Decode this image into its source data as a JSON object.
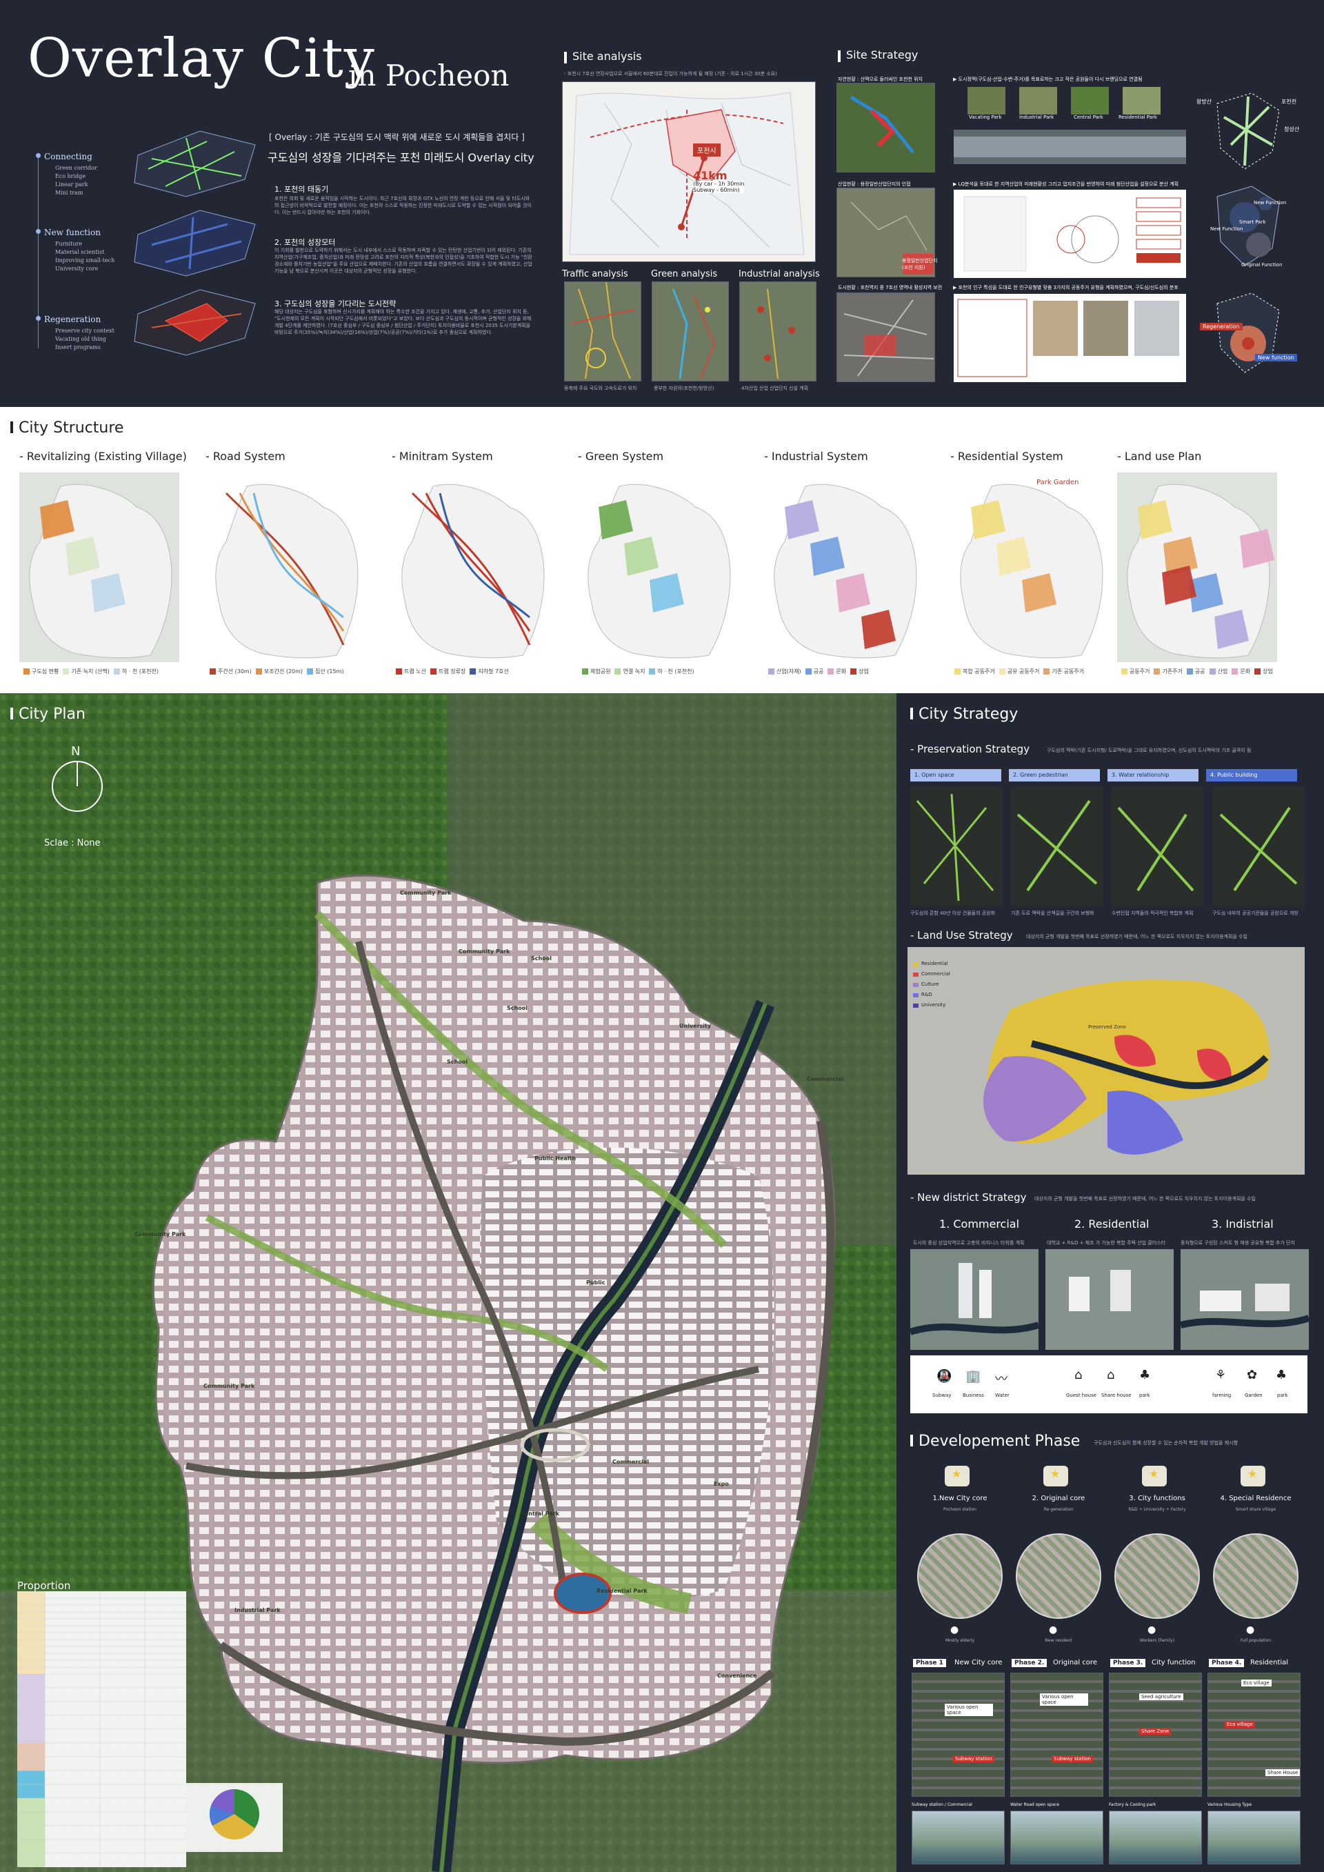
{
  "header": {
    "title": "Overlay City",
    "subtitle": "in Pocheon",
    "overlay_heading": "[ Overlay : 기존 구도심의 도시 맥락 위에 새로운 도시 계획들을 겹치다 ]",
    "overlay_tagline": "구도심의 성장을 기다려주는 포천 미래도시 Overlay city"
  },
  "layers": [
    {
      "label": "Connecting",
      "items": [
        "Green corridor",
        "Eco bridge",
        "Linear park",
        "Mini tram"
      ]
    },
    {
      "label": "New function",
      "items": [
        "Furniture",
        "Material scientist",
        "Improving small-tech",
        "University core"
      ]
    },
    {
      "label": "Regeneration",
      "items": [
        "Preserve city context",
        "Vacating old thing",
        "Insert programs"
      ]
    }
  ],
  "sections": [
    {
      "heading": "1. 포천의 태동기",
      "body": "포천은 의회 및 새로운 움직임을 시작하는 도시이다. 최근 7호선의 확장과 GTX 노선의 연장 계란 등으로 인해 서울 및 타도시와의 접근성이 비약적으로 발전할 예정이다. 이는 포천의 스스로 작동하는 진정한 미래도시로 도약할 수 있는 시작점이 되어줄 것이다. 이는 반드시 잡아야만 하는 포천의 기회이다."
    },
    {
      "heading": "2. 포천의 성장모터",
      "body": "이 기회를 발판으로 도약하기 위해서는 도시 내부에서 스스로 작동하며 자족할 수 있는 탄탄한 산업기반이 되어 제외된다. 기존의 지역산업(가구제조업, 중처산업)과 미래 전망성 고려로 포천의 지리적 특성(북한과의 인접성)을 기초하여 적합한 도시 기능 \"친환경소재와 중처기반 농업산업\"을 주요 산업으로 제배치한다. 기존의 산업의 흐름을 연결하면서도 확장될 수 있게 계획하였고, 산업기능을 남 북으로 분산시켜 이곳은 대상지의 균형적인 성장을 유형한다."
    },
    {
      "heading": "3. 구도심의 성장을 기다리는 도시전략",
      "body": "해당 대상지는 구도심을 포함하며 신시가지를 계획해야 하는 특수한 조건을 가지고 있다. 재생에, 교통, 추가, 산업단지 위치 등, \"도시현재의 모든 계획이 시작되던 구도심에서 비롯되었다\"고 보았다. 보다 산도심과 구도심의 동시적이며 균형적인 성장을 위해 개발 4단계를 제안하였다. (7호선 중심부 / 구도심 중심부 / 첨단산업 / 주거단지) 토지이용비율로 포천시 2035 도시기본계획을 바탕으로 주거(35%)/녹지(34%)/산업(16%)/상업(7%)/공공(7%)/기타(1%)로 추가 중심으로 계획하였다."
    }
  ],
  "site_analysis": {
    "title": "Site analysis",
    "caption": "- 포천시 7호선 연장사업으로 서울에서 60분대로 진입이 가능하게 될 예정 (기준 - 의료 1시간 30분 소요)",
    "callout_city": "포천시",
    "callout_distance": "41km",
    "callout_detail": "(By car - 1h 30min\nSubway - 60min)",
    "sub_panels": [
      {
        "label": "Traffic analysis",
        "caption": "동축에 주요 국도와 고속도로가 위치"
      },
      {
        "label": "Green analysis",
        "caption": "풍부한 자원의(포천천/왕방산)"
      },
      {
        "label": "Industrial analysis",
        "caption": "4차산업 산업 산업단지 신설 계획"
      }
    ]
  },
  "site_strategy": {
    "title": "Site Strategy",
    "rows": [
      {
        "left_caption": "자연현황 : 산맥으로 둘러싸인 포천천 위치",
        "note": "▶ 도시정맥(구도심-산업-수변-주거)를 목표로하는 크고 작은 공원들이 다시 브랜딩으로 연결됨",
        "parks": [
          "Vacating Park",
          "Industrial Park",
          "Central Park",
          "Residential Park"
        ],
        "callouts": [
          "왕방산",
          "포천천",
          "청성산"
        ]
      },
      {
        "left_caption": "산업현황 : 용정일반산업단지의 인접",
        "note": "▶ LQ분석을 토대로 한 지역산업의 미래현황성 그리고 업지조건을 반영하여 미래 첨단산업을 설정으로 분산 계획",
        "callouts": [
          "New Function",
          "Smart Park",
          "New Function",
          "Original Function"
        ],
        "badge": "용정일반산업단지\n(포천 지원)"
      },
      {
        "left_caption": "도시현황 : 포천역지 중 7호선 영역내 활성지역 보전",
        "note": "▶ 포천의 인구 특성을 도대로 한 인구유형별 맞춤 3가지의 공동주거 유형을 계획하였으며, 구도심/신도심의 분포",
        "callouts": [
          "Regeneration",
          "New function"
        ]
      }
    ]
  },
  "city_structure": {
    "title": "City Structure",
    "panels": [
      {
        "title": "- Revitalizing (Existing Village)",
        "legend": [
          "구도심 현황",
          "기존 녹지 (산맥)",
          "하 · 천 (포천천)"
        ],
        "colors": [
          "#e08a3c",
          "#d9e8c9",
          "#bfd7ea"
        ]
      },
      {
        "title": "- Road System",
        "legend": [
          "주간선 (30m)",
          "보조간선 (20m)",
          "집산 (15m)"
        ],
        "colors": [
          "#b5452e",
          "#e0924b",
          "#6bb6e6"
        ]
      },
      {
        "title": "- Minitram System",
        "legend": [
          "트램 노선",
          "트램 정류장",
          "지하철 7호선"
        ],
        "colors": [
          "#c0392b",
          "#c0392b",
          "#345ea8"
        ]
      },
      {
        "title": "- Green System",
        "legend": [
          "체험공원",
          "연결 녹지",
          "하 · 천 (포천천)"
        ],
        "colors": [
          "#6aa84f",
          "#b5d89b",
          "#7dc3e8"
        ]
      },
      {
        "title": "- Industrial System",
        "legend": [
          "산업(자재)",
          "공공",
          "문화",
          "상업"
        ],
        "colors": [
          "#b3a9e0",
          "#6f9fe0",
          "#e6a6c8",
          "#c0392b"
        ]
      },
      {
        "title": "- Residential System",
        "legend": [
          "복합 공동주거",
          "공유 공동주거",
          "기존 공동주거"
        ],
        "colors": [
          "#f0dc7a",
          "#f5e8a8",
          "#e8a35e"
        ],
        "marks": "Park  Garden"
      },
      {
        "title": "- Land use Plan",
        "legend": [
          "공동주거",
          "기존주거",
          "공공",
          "산업",
          "문화",
          "상업"
        ],
        "colors": [
          "#f0dc7a",
          "#e8a35e",
          "#6f9fe0",
          "#b3a9e0",
          "#e6a6c8",
          "#c0392b"
        ]
      }
    ]
  },
  "city_plan": {
    "title": "City Plan",
    "compass": "N",
    "scale": "Sclae : None",
    "labels": [
      "Community Park",
      "Community Park",
      "School",
      "School",
      "School",
      "University",
      "Community Park",
      "Public Health",
      "Commercial",
      "Public",
      "Commercial",
      "Expo",
      "Central Park",
      "Residential Park",
      "Industrial Park",
      "Community Park",
      "Convenience"
    ],
    "proportion": {
      "title": "Proportion"
    }
  },
  "city_strategy": {
    "title": "City Strategy",
    "preservation": {
      "title": "- Preservation Strategy",
      "note": "구도심의 맥락(기존 도시지형/ 도로맥락)을 그대로 유지하였으며, 신도심의 도시맥락의 기초 골격이 됨",
      "tabs": [
        "1. Open space",
        "2. Green pedestrian",
        "3. Water relationship",
        "4. Public building"
      ],
      "captions": [
        "구도심의 흔함 40년 이상 건물들의 공원화",
        "기존 도로 맥락을 산책길을 구간의 보행화",
        "수변인접 지역들의 적극적인 복합화 계획",
        "구도심 내부의 공공기관들을 공원으로 개방"
      ]
    },
    "land_use": {
      "title": "- Land Use Strategy",
      "note": "대상지의 균형 개발을 첫번째 목표로 선정하였기 때문에, 어느 한 쪽으로도 치우치지 않는 토지이용계획을 수립",
      "legend": [
        "Residential",
        "Commercial",
        "Culture",
        "R&D",
        "University"
      ],
      "colors": [
        "#e0c13e",
        "#e0404a",
        "#9f7fcb",
        "#6f6fdd",
        "#4d3f9e"
      ],
      "map_label": "Preserved Zone"
    },
    "new_district": {
      "title": "- New district Strategy",
      "note": "대상지의 균형 개발을 첫번째 목표로 선정하였기 때문에, 어느 한 쪽으로도 치우치지 않는 토지이용계획을 수립",
      "columns": [
        {
          "title": "1. Commercial",
          "caption": "도시의 중심 상업지역으로 고층의 비지니스 타워를 계획"
        },
        {
          "title": "2. Residential",
          "caption": "대학교 + R&D + 제조 가 가능한 복합 주택 산업 클러스터"
        },
        {
          "title": "3. Indistrial",
          "caption": "중처형으로 구성된 스커트 형 재생 공유형 복합 추가 단지"
        }
      ],
      "icons": [
        "Subway",
        "Business",
        "Water",
        "Guest house",
        "Share house",
        "park",
        "farming",
        "Garden",
        "park"
      ]
    },
    "phase": {
      "title": "Developement Phase",
      "note": "구도심과 신도심이 함께 성장할 수 있는 순차적 복합 개발 방법을 제시함",
      "steps": [
        {
          "title": "1.New City core",
          "sub": "Pocheon station",
          "people": "Mostly elderly",
          "phase_tag": "Phase 1",
          "phase_title": "New City core",
          "bottom": "Subway station / Commercial"
        },
        {
          "title": "2. Original core",
          "sub": "Re-generation",
          "people": "New resident",
          "phase_tag": "Phase 2.",
          "phase_title": "Original core",
          "bottom": "Water Road open space"
        },
        {
          "title": "3. City functions",
          "sub": "R&D + University + Factory",
          "people": "Workers (Family)",
          "phase_tag": "Phase 3.",
          "phase_title": "City function",
          "bottom": "Factory & Cooling park"
        },
        {
          "title": "4. Special Residence",
          "sub": "Smart share village",
          "people": "Full population",
          "phase_tag": "Phase 4.",
          "phase_title": "Residential",
          "bottom": "Various Housing Type"
        }
      ],
      "map_tags": [
        "Various open space",
        "Subway station",
        "Various open space",
        "Subway station",
        "Seed agriculture",
        "Share Zone",
        "Eco village",
        "Eco village",
        "Share House"
      ]
    }
  }
}
